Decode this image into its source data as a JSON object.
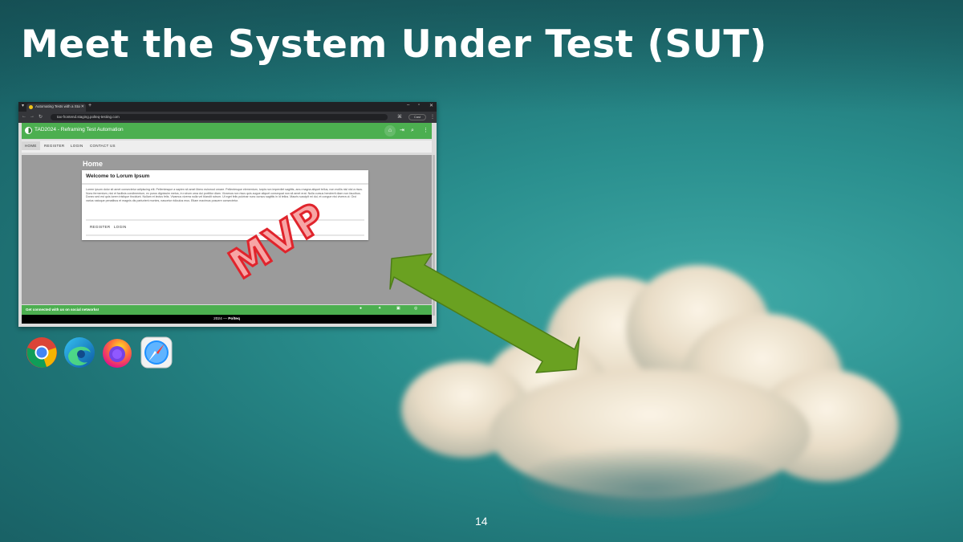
{
  "slide": {
    "title": "Meet the System Under Test (SUT)",
    "page_number": "14",
    "stamp_text": "MVP"
  },
  "browser": {
    "tab_title": "Automating Tests with a Story...",
    "url": "tax-frontend.staging.polteq-testing.com",
    "cast_label": "Cast",
    "app_title": "TAD2024 - Reframing Test Automation",
    "nav": {
      "home": "HOME",
      "register": "REGISTER",
      "login": "LOGIN",
      "contact": "CONTACT US"
    },
    "page_heading": "Home",
    "card": {
      "title": "Welcome to Lorum Ipsum",
      "body": "Lorem ipsum dolor sit amet consectetur adipiscing elit. Pellentesque a sapien sit amet libero euismod ornare. Pellentesque elementum, turpis non imperdiet sagittis, arcu magna aliquet tellus, non mollis nisl nisl a risus. Nunc fermentum, nisi et facilisis condimentum, ex purus dignissim metus, in rutrum urna dui porttitor diam. Vivamus non risus quis augue aliquet consequat non sit amet erat. Nulla cursus hendrerit diam non faucibus. Donec sed est quis lorem tristique tincidunt. Nullam et lectus felis. Vivamus viverra nulla vel blandit rutrum. Ut eget felis pulvinar nunc cursus sagittis in id tellus. Mauris suscipit mi dui, et congue nisi viverra ut. Orci varius natoque penatibus et magnis dis parturient montes, nascetur ridiculus mus. Etiam maximus posuere consectetur.",
      "action_register": "REGISTER",
      "action_login": "LOGIN"
    },
    "footer_social": "Get connected with us on social networks!",
    "footer_copy_prefix": "2024 — ",
    "footer_copy_brand": "Polteq"
  },
  "icons": [
    "chrome-icon",
    "edge-icon",
    "firefox-icon",
    "safari-icon"
  ]
}
